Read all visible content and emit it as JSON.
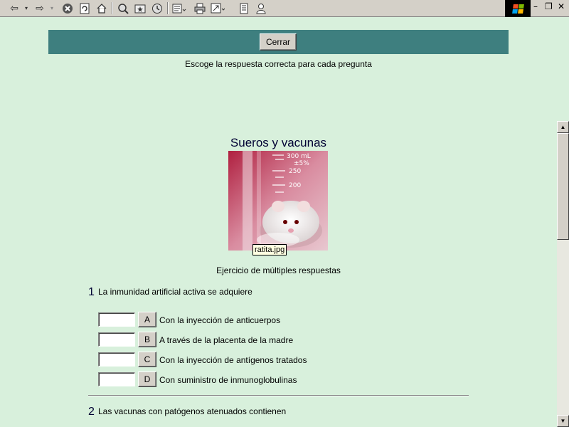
{
  "toolbar": {
    "icons": [
      "back-icon",
      "back-dropdown-icon",
      "forward-icon",
      "forward-dropdown-icon",
      "stop-icon",
      "refresh-icon",
      "home-icon",
      "search-icon",
      "favorites-icon",
      "history-icon",
      "mail-icon",
      "print-icon",
      "fullscreen-icon",
      "edit-icon",
      "messenger-icon"
    ]
  },
  "window_controls": {
    "minimize": "–",
    "restore": "❐",
    "close": "✕"
  },
  "header": {
    "close_label": "Cerrar"
  },
  "instructions": "Escoge la respuesta correcta para cada pregunta",
  "exercise": {
    "title": "Sueros y vacunas",
    "image_tooltip": "ratita.jpg",
    "subtitle": "Ejercicio de múltiples respuestas"
  },
  "questions": [
    {
      "number": "1",
      "text": "La inmunidad artificial activa se adquiere",
      "options": [
        {
          "letter": "A",
          "text": "Con la inyección de anticuerpos",
          "value": ""
        },
        {
          "letter": "B",
          "text": "A través de la placenta de la madre",
          "value": ""
        },
        {
          "letter": "C",
          "text": "Con la inyección de antígenos tratados",
          "value": ""
        },
        {
          "letter": "D",
          "text": "Con suministro de inmunoglobulinas",
          "value": ""
        }
      ]
    },
    {
      "number": "2",
      "text": "Las vacunas con patógenos atenuados contienen"
    }
  ],
  "colors": {
    "page_bg": "#d8f0dc",
    "header_bar": "#3e7f7f",
    "title_text": "#000033"
  }
}
